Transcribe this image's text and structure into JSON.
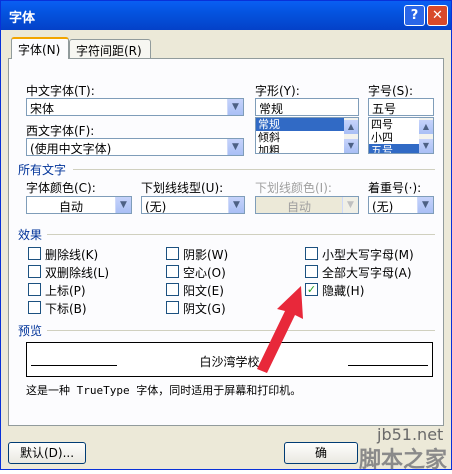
{
  "window": {
    "title": "字体",
    "help_label": "?",
    "close_label": "✕"
  },
  "tabs": [
    {
      "label": "字体(N)"
    },
    {
      "label": "字符间距(R)"
    }
  ],
  "font": {
    "chinese_label": "中文字体(T):",
    "chinese_value": "宋体",
    "western_label": "西文字体(F):",
    "western_value": "(使用中文字体)",
    "style_label": "字形(Y):",
    "style_value": "常规",
    "style_options": [
      "常规",
      "倾斜",
      "加粗"
    ],
    "style_selected": "常规",
    "size_label": "字号(S):",
    "size_value": "五号",
    "size_options": [
      "四号",
      "小四",
      "五号"
    ],
    "size_selected": "五号"
  },
  "all_text": {
    "section_label": "所有文字",
    "color_label": "字体颜色(C):",
    "color_value": "自动",
    "underline_label": "下划线线型(U):",
    "underline_value": "(无)",
    "underline_color_label": "下划线颜色(I):",
    "underline_color_value": "自动",
    "emphasis_label": "着重号(·):",
    "emphasis_value": "(无)"
  },
  "effects": {
    "section_label": "效果",
    "items": [
      {
        "label": "删除线(K)",
        "checked": false
      },
      {
        "label": "双删除线(L)",
        "checked": false
      },
      {
        "label": "上标(P)",
        "checked": false
      },
      {
        "label": "下标(B)",
        "checked": false
      },
      {
        "label": "阴影(W)",
        "checked": false
      },
      {
        "label": "空心(O)",
        "checked": false
      },
      {
        "label": "阳文(E)",
        "checked": false
      },
      {
        "label": "阴文(G)",
        "checked": false
      },
      {
        "label": "小型大写字母(M)",
        "checked": false
      },
      {
        "label": "全部大写字母(A)",
        "checked": false
      },
      {
        "label": "隐藏(H)",
        "checked": true
      }
    ]
  },
  "preview": {
    "section_label": "预览",
    "sample_text": "白沙湾学校",
    "note": "这是一种 TrueType 字体，同时适用于屏幕和打印机。"
  },
  "buttons": {
    "default_label": "默认(D)...",
    "ok_label": "确"
  },
  "annotation": {
    "arrow_color": "#e8283a"
  },
  "watermark": {
    "site": "jb51.net",
    "name": "脚本之家"
  }
}
